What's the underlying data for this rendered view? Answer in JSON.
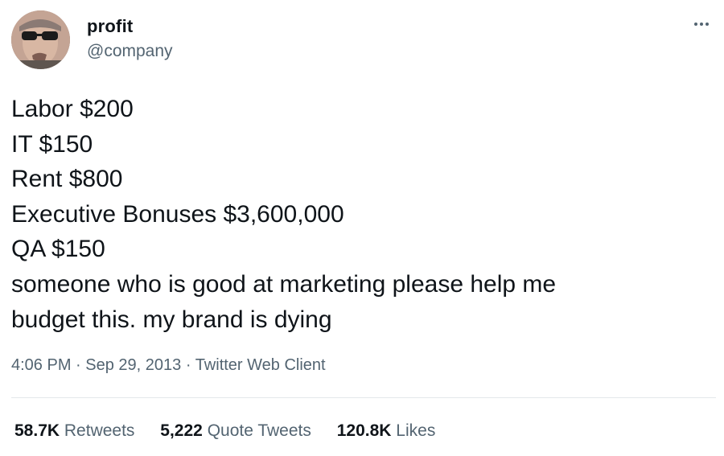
{
  "tweet": {
    "display_name": "profit",
    "handle": "@company",
    "lines": [
      "Labor $200",
      "IT $150",
      "Rent $800",
      "Executive Bonuses $3,600,000",
      "QA $150",
      "someone who is good at marketing please help me",
      "budget this. my brand is dying"
    ],
    "time": "4:06 PM",
    "separator": " · ",
    "date": "Sep 29, 2013",
    "source": "Twitter Web Client",
    "stats": {
      "retweets_count": "58.7K",
      "retweets_label": "Retweets",
      "quotes_count": "5,222",
      "quotes_label": "Quote Tweets",
      "likes_count": "120.8K",
      "likes_label": "Likes"
    }
  },
  "icons": {
    "avatar": "profile-photo",
    "more": "more-options-icon"
  },
  "colors": {
    "text_primary": "#0f1419",
    "text_secondary": "#536471",
    "divider": "#e4e8eb"
  }
}
